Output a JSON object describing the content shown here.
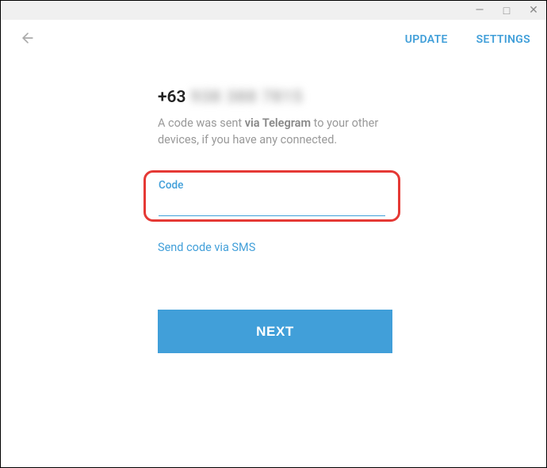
{
  "window": {
    "minimize": "—",
    "maximize": "□",
    "close": "✕"
  },
  "header": {
    "back": "←",
    "update": "UPDATE",
    "settings": "SETTINGS"
  },
  "phone": {
    "prefix": "+63",
    "blurred": "938 388 7815"
  },
  "desc": {
    "part1": "A code was sent ",
    "bold": "via Telegram",
    "part2": " to your other devices, if you have any connected."
  },
  "code": {
    "label": "Code",
    "value": ""
  },
  "links": {
    "sms": "Send code via SMS"
  },
  "buttons": {
    "next": "NEXT"
  }
}
